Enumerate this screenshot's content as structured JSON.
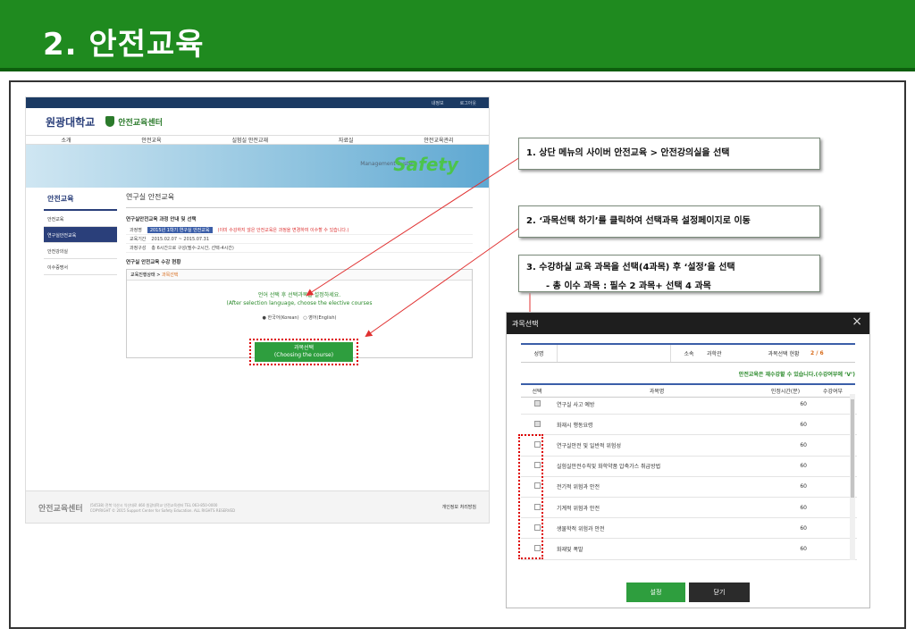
{
  "slide": {
    "title": "2. 안전교육"
  },
  "site": {
    "topbar": [
      "내정보",
      "로그아웃"
    ],
    "logo_univ": "원광대학교",
    "logo_center": "안전교육센터",
    "nav": [
      "소개",
      "안전교육",
      "실험실 안전교재",
      "자료실",
      "안전교육관리"
    ],
    "banner_text": "Safety",
    "banner_sub": "Management System",
    "lnb_title": "안전교육",
    "lnb_items": [
      "안전교육",
      "연구실안전교육",
      "안전강의실",
      "이수증명서"
    ],
    "content_title": "연구실 안전교육",
    "sec1": "연구실안전교육 과정 안내 및 선택",
    "row_course_label": "과정명",
    "row_course_value": "2015년 1학기 연구실 안전교육",
    "row_course_note": "(이미 수강하지 않은 안전교육은 과정을 변경하여 이수할 수 있습니다.)",
    "row_period_label": "교육기간",
    "row_period_value": "2015.02.07 ~ 2015.07.31",
    "row_comp_label": "과정구성",
    "row_comp_value": "총 6시간으로 구성(필수-2시간, 선택-4시간)",
    "sec2": "연구실 안전교육 수강 현황",
    "status_label": "교육진행상태 >",
    "status_value": "과목선택",
    "prompt_kr": "언어 선택 후 선택과목을 설정하세요.",
    "prompt_en": "(After selection language, choose the elective courses",
    "lang_ko": "한국어(Korean)",
    "lang_en": "영어(English)",
    "choose_btn": "과목선택",
    "choose_btn_en": "(Choosing the course)",
    "footer_logo": "안전교육센터",
    "footer_addr": "(54538) 전북 익산시 익산대로 460 원광대학교 안전교육센터 TEL 063-850-0000",
    "footer_copy": "COPYRIGHT © 2015 Support Center for Safety Education. ALL RIGHTS RESERVED",
    "footer_link": "개인정보 처리방침"
  },
  "callouts": {
    "c1": "1. 상단 메뉴의 사이버 안전교육 > 안전강의실을 선택",
    "c2": "2. ‘과목선택 하기’를 클릭하여 선택과목 설정페이지로 이동",
    "c3": "3. 수강하실 교육 과목을 선택(4과목) 후 ‘설정’을 선택",
    "c3_sub": "- 총 이수 과목 : 필수 2 과목+ 선택 4 과목"
  },
  "modal": {
    "title": "과목선택",
    "label_name": "성명",
    "label_org": "소속",
    "value_org": "과학관",
    "label_status": "과목선택 현황",
    "value_status": "2 / 6",
    "note": "안전교육은 재수강할 수 있습니다.(수강여부에 ‘V’)",
    "headers": [
      "선택",
      "과목명",
      "인정시간(분)",
      "수강여부"
    ],
    "rows": [
      {
        "name": "연구실 사고 예방",
        "time": "60",
        "checked": true
      },
      {
        "name": "화재시 행동요령",
        "time": "60",
        "checked": true
      },
      {
        "name": "연구실안전 및 일반적 위험성",
        "time": "60",
        "checked": false
      },
      {
        "name": "실험실안전수칙및 화학약품 압축가스 취급방법",
        "time": "60",
        "checked": false
      },
      {
        "name": "전기적 위험과 안전",
        "time": "60",
        "checked": false
      },
      {
        "name": "기계적 위험과 안전",
        "time": "60",
        "checked": false
      },
      {
        "name": "생물학적 위험과 안전",
        "time": "60",
        "checked": false
      },
      {
        "name": "화재및 폭발",
        "time": "60",
        "checked": false
      }
    ],
    "btn_set": "설정",
    "btn_close": "닫기"
  }
}
